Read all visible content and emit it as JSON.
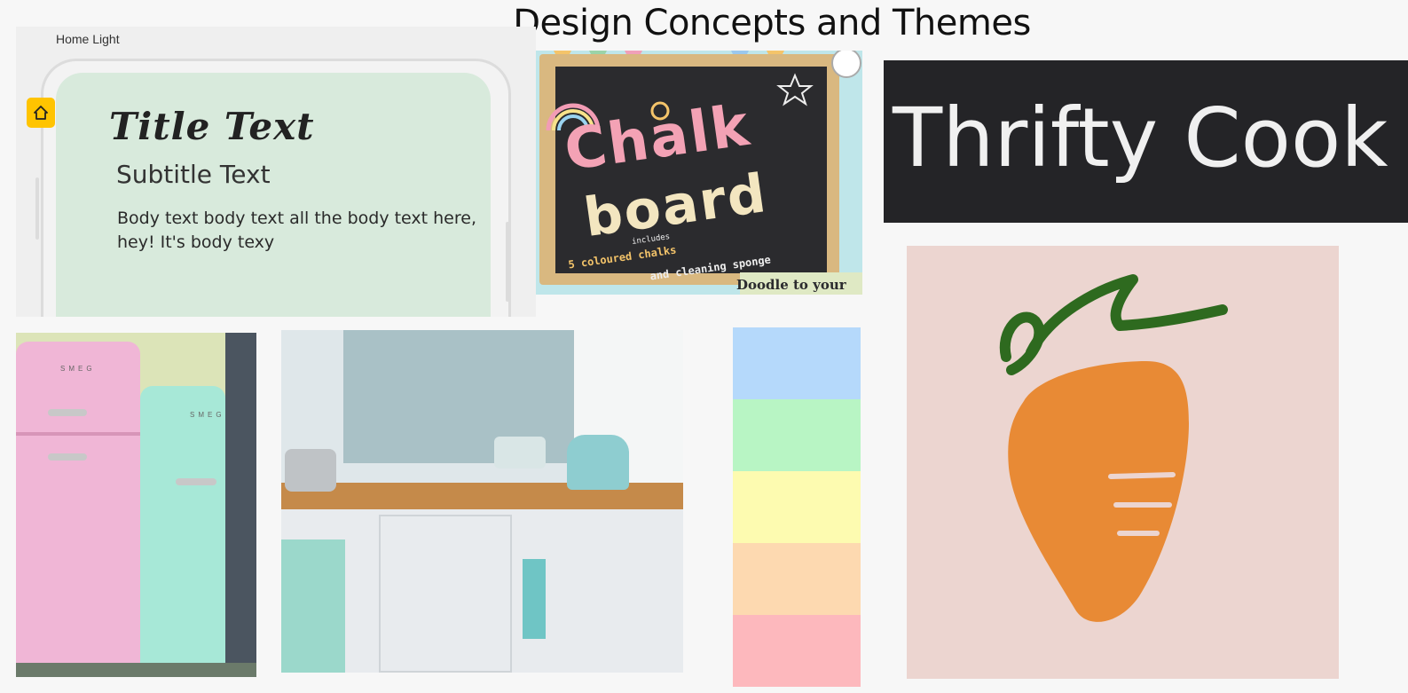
{
  "page": {
    "title": "Design Concepts and Themes"
  },
  "phone_mockup": {
    "label": "Home Light",
    "title_text": "Title Text",
    "subtitle_text": "Subtitle Text",
    "body_text": "Body text body text all the body text here, hey! It's body texy",
    "screen_color": "#d8eadc",
    "home_badge_icon": "home-icon",
    "badge_color": "#ffc400"
  },
  "chalkboard": {
    "word1": "Chalk",
    "word2": "board",
    "line1": "includes",
    "line2": "5 coloured chalks",
    "line3": "and cleaning sponge",
    "corner": "Doodle to your"
  },
  "banner": {
    "text": "Thrifty Cook",
    "bg": "#242427"
  },
  "logo": {
    "icon": "carrot-icon",
    "bg": "#ecd5d0",
    "carrot_color": "#e88a35",
    "stem_color": "#2e6a1f"
  },
  "fridges": {
    "brand": "SMEG"
  },
  "palette": {
    "colors": [
      "#b5d9fb",
      "#b8f5c4",
      "#fdfbb0",
      "#fdd9b0",
      "#fdb8bd"
    ]
  }
}
